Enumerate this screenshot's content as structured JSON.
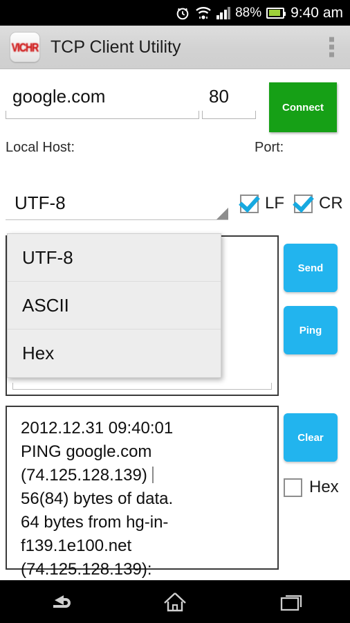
{
  "statusbar": {
    "alarm_icon": "alarm-clock-icon",
    "wifi_icon": "wifi-icon",
    "signal_icon": "cellular-signal-icon",
    "battery_percent": "88%",
    "battery_icon": "battery-icon",
    "time": "9:40 am"
  },
  "actionbar": {
    "logo_text": "VICHR",
    "logo_icon": "app-logo-icon",
    "title": "TCP Client Utility",
    "overflow_icon": "overflow-menu-icon"
  },
  "connection": {
    "host_value": "google.com",
    "host_placeholder": "Local Host",
    "port_value": "80",
    "port_placeholder": "Port",
    "connect_label": "Connect",
    "connect_color": "#16a016",
    "host_label": "Local Host:",
    "port_label": "Port:"
  },
  "encoding": {
    "selected": "UTF-8",
    "options": [
      "UTF-8",
      "ASCII",
      "Hex"
    ],
    "dropdown_open": true,
    "caret_icon": "dropdown-caret-icon"
  },
  "line_endings": {
    "lf_label": "LF",
    "lf_checked": true,
    "cr_label": "CR",
    "cr_checked": true,
    "check_color": "#17a9e0"
  },
  "send_area": {
    "value": "",
    "placeholder": ""
  },
  "log_area": {
    "text": "2012.12.31 09:40:01\nPING google.com\n(74.125.128.139)\n56(84) bytes of data.\n64 bytes from hg-in-\nf139.1e100.net\n(74.125.128.139):"
  },
  "actions": {
    "send_label": "Send",
    "ping_label": "Ping",
    "clear_label": "Clear",
    "button_color": "#22b4ee",
    "hex_label": "Hex",
    "hex_checked": false
  },
  "navbar": {
    "back_icon": "back-arrow-icon",
    "home_icon": "home-icon",
    "recents_icon": "recent-apps-icon"
  }
}
